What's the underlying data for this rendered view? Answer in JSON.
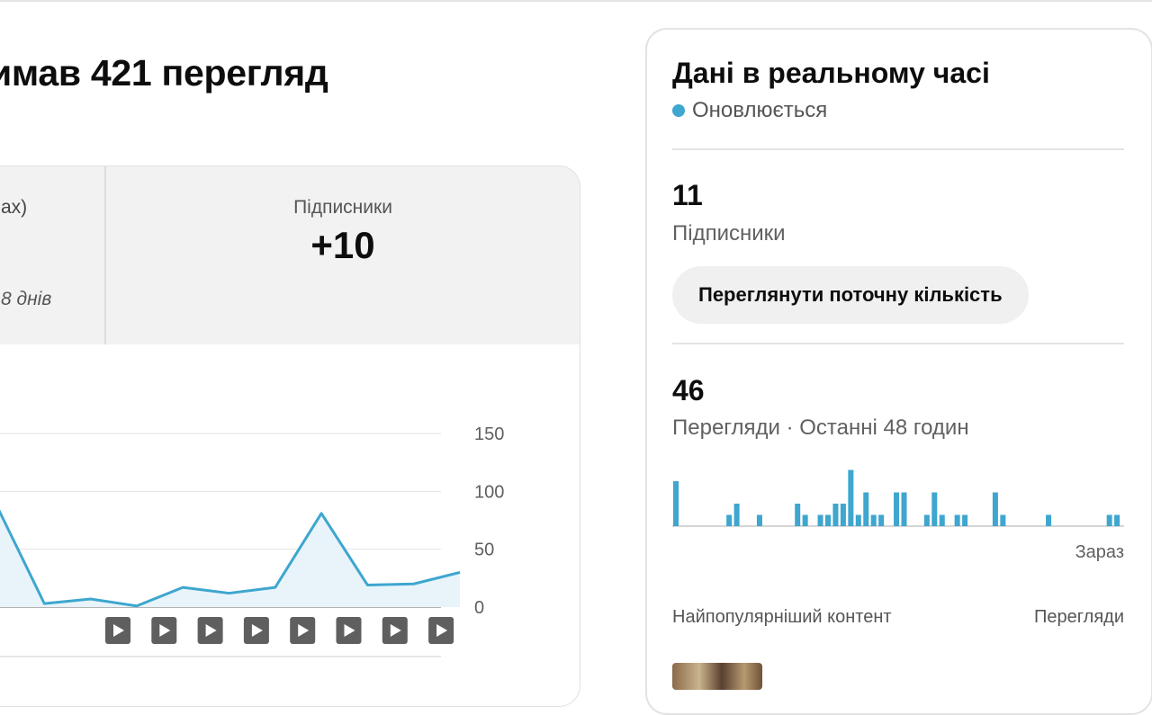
{
  "headline": "имав 421 перегляд",
  "analytics": {
    "stat_cut_label": "ах)",
    "stat_cut_sub": "8 днів",
    "subscribers_label": "Підписники",
    "subscribers_value": "+10"
  },
  "chart_data": {
    "type": "area",
    "x": [
      0,
      1,
      2,
      3,
      4,
      5,
      6,
      7,
      8,
      9,
      10
    ],
    "values": [
      85,
      3,
      7,
      1,
      17,
      12,
      17,
      81,
      19,
      20,
      30
    ],
    "ylim": [
      0,
      150
    ],
    "y_ticks": [
      "150",
      "100",
      "50",
      "0"
    ],
    "grid": true,
    "line_color": "#3ea6cf",
    "fill_color": "#e8f4fa",
    "video_markers": 8
  },
  "realtime": {
    "title": "Дані в реальному часі",
    "status": "Оновлюється",
    "status_color": "#3ea6cf",
    "subscribers_count": "11",
    "subscribers_label": "Підписники",
    "view_count_button": "Переглянути поточну кількість",
    "views_count": "46",
    "views_label": "Перегляди · Останні 48 годин",
    "now_label": "Зараз",
    "top_content_label": "Найпопулярніший контент",
    "top_views_label": "Перегляди",
    "hourly_views": [
      4,
      0,
      0,
      0,
      0,
      0,
      0,
      1,
      2,
      0,
      0,
      1,
      0,
      0,
      0,
      0,
      2,
      1,
      0,
      1,
      1,
      2,
      2,
      5,
      1,
      3,
      1,
      1,
      0,
      3,
      3,
      0,
      0,
      1,
      3,
      1,
      0,
      1,
      1,
      0,
      0,
      0,
      3,
      1,
      0,
      0,
      0,
      0,
      0,
      1,
      0,
      0,
      0,
      0,
      0,
      0,
      0,
      1,
      1
    ]
  }
}
